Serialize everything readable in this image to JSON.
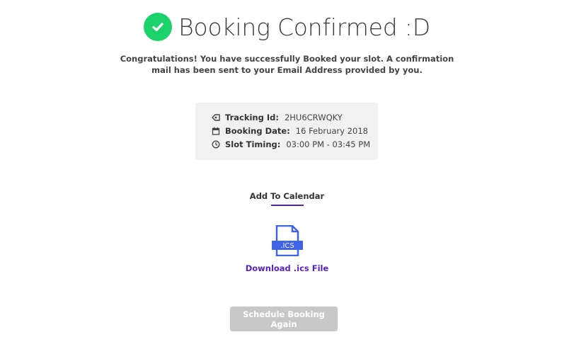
{
  "header": {
    "title": "Booking Confirmed :D",
    "icon": "check-circle-icon"
  },
  "message": {
    "line1": "Congratulations! You have successfully Booked your slot. A confirmation",
    "line2": "mail has been sent to your Email Address provided by you."
  },
  "details": [
    {
      "icon": "tag-icon",
      "label": "Tracking Id:",
      "value": "2HU6CRWQKY"
    },
    {
      "icon": "calendar-icon",
      "label": "Booking Date:",
      "value": "16 February 2018"
    },
    {
      "icon": "clock-icon",
      "label": "Slot Timing:",
      "value": "03:00 PM - 03:45 PM"
    }
  ],
  "calendar": {
    "title": "Add To Calendar",
    "file_icon": "ics-file-icon",
    "file_badge": ".ICS",
    "download_label": "Download .ics File"
  },
  "actions": {
    "schedule_again_label": "Schedule Booking Again"
  },
  "colors": {
    "success": "#1bd36a",
    "accent": "#5a1ec9",
    "file_icon": "#3f64e8",
    "button_disabled": "#c8c8c8"
  }
}
